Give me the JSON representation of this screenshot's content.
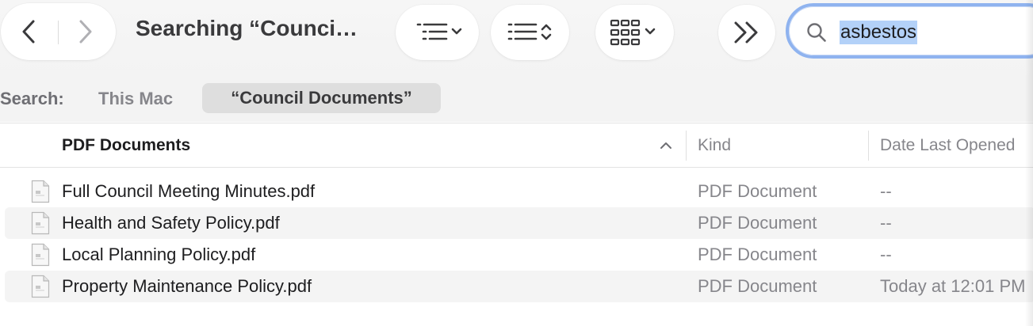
{
  "window": {
    "title": "Searching “Counci…"
  },
  "toolbar": {
    "back_icon": "chevron-left-icon",
    "forward_icon": "chevron-right-icon",
    "group_icon": "list-indent-icon",
    "sort_icon": "list-sort-icon",
    "view_icon": "grid-view-icon",
    "more_icon": "double-chevron-right-icon"
  },
  "search": {
    "query": "asbestos",
    "icon": "magnifier-icon"
  },
  "scope": {
    "label": "Search:",
    "this_mac": "This Mac",
    "current": "“Council Documents”"
  },
  "columns": {
    "name": "PDF Documents",
    "kind": "Kind",
    "date": "Date Last Opened"
  },
  "files": [
    {
      "name": "Full Council Meeting Minutes.pdf",
      "kind": "PDF Document",
      "date": "--"
    },
    {
      "name": "Health and Safety Policy.pdf",
      "kind": "PDF Document",
      "date": "--"
    },
    {
      "name": "Local Planning Policy.pdf",
      "kind": "PDF Document",
      "date": "--"
    },
    {
      "name": "Property Maintenance Policy.pdf",
      "kind": "PDF Document",
      "date": "Today at 12:01 PM"
    }
  ],
  "colors": {
    "accent_focus": "#8fb3ef",
    "selection": "#b3d1f8",
    "toolbar_bg": "#f3f3f3",
    "row_alt": "#f4f4f4"
  }
}
